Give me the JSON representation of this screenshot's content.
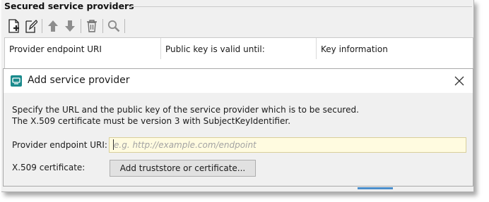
{
  "group": {
    "title": "Secured service providers"
  },
  "toolbar": {
    "buttons": [
      {
        "name": "add-icon"
      },
      {
        "name": "edit-icon"
      },
      {
        "name": "move-up-icon"
      },
      {
        "name": "move-down-icon"
      },
      {
        "name": "delete-icon"
      },
      {
        "name": "search-icon"
      }
    ]
  },
  "table": {
    "columns": [
      "Provider endpoint URI",
      "Public key is valid until:",
      "Key information"
    ]
  },
  "dialog": {
    "title": "Add service provider",
    "description_line1": "Specify the URL and the public key of the service provider which is to be secured.",
    "description_line2": "The X.509 certificate must be version 3 with SubjectKeyIdentifier.",
    "endpoint_label": "Provider endpoint URI:",
    "endpoint_value": "",
    "endpoint_placeholder": "e.g. http://example.com/endpoint",
    "certificate_label": "X.509 certificate:",
    "add_button": "Add truststore or certificate..."
  },
  "colors": {
    "accent": "#1a8a8c",
    "input_background": "#fffbe0"
  }
}
